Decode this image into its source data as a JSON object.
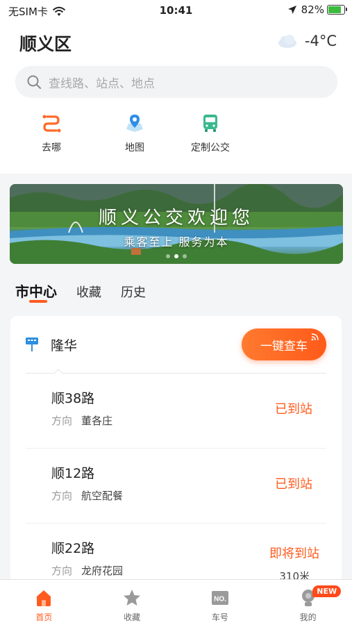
{
  "status_bar": {
    "carrier": "无SIM卡",
    "time": "10:41",
    "battery": "82%",
    "battery_level": 0.82
  },
  "header": {
    "location": "顺义区",
    "temperature": "-4°C",
    "weather_icon": "cloud-icon"
  },
  "search": {
    "placeholder": "查线路、站点、地点"
  },
  "quick_actions": [
    {
      "label": "去哪",
      "icon": "route-icon"
    },
    {
      "label": "地图",
      "icon": "map-pin-icon"
    },
    {
      "label": "定制公交",
      "icon": "bus-icon"
    }
  ],
  "banner": {
    "title": "顺义公交欢迎您",
    "subtitle": "乘客至上 服务为本",
    "dots": 3,
    "active_dot": 1
  },
  "tabs": [
    {
      "label": "市中心",
      "active": true
    },
    {
      "label": "收藏",
      "active": false
    },
    {
      "label": "历史",
      "active": false
    }
  ],
  "stop": {
    "name": "隆华",
    "query_button": "一键查车"
  },
  "routes": [
    {
      "name": "顺38路",
      "direction_label": "方向",
      "direction": "董各庄",
      "status": "已到站",
      "distance": ""
    },
    {
      "name": "顺12路",
      "direction_label": "方向",
      "direction": "航空配餐",
      "status": "已到站",
      "distance": ""
    },
    {
      "name": "顺22路",
      "direction_label": "方向",
      "direction": "龙府花园",
      "status": "即将到站",
      "distance": "310米"
    }
  ],
  "bottom_nav": [
    {
      "label": "首页",
      "icon": "home-icon",
      "active": true
    },
    {
      "label": "收藏",
      "icon": "star-icon",
      "active": false
    },
    {
      "label": "车号",
      "icon": "bus-number-icon",
      "active": false
    },
    {
      "label": "我的",
      "icon": "profile-icon",
      "active": false,
      "badge": "NEW"
    }
  ],
  "colors": {
    "accent": "#ff5b1f",
    "status": "#ff5b1f"
  }
}
